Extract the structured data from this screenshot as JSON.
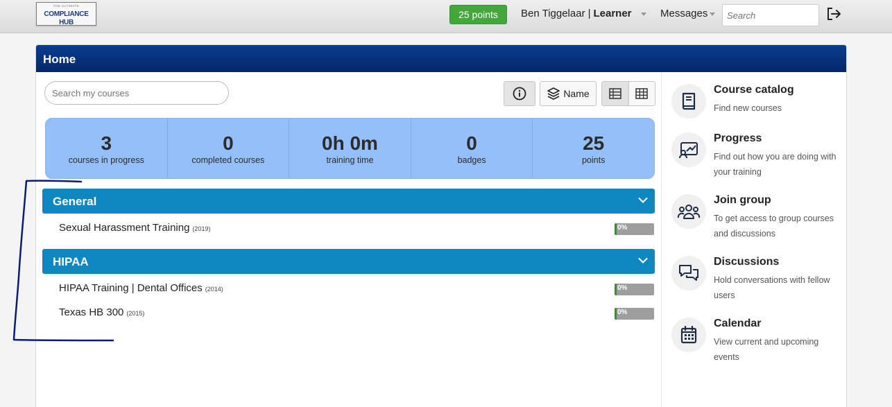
{
  "topbar": {
    "logo_small": "THE ULTIMATE",
    "logo_main": "COMPLIANCE HUB",
    "points_badge": "25 points",
    "user_name": "Ben Tiggelaar",
    "separator": "|",
    "user_role": "Learner",
    "messages_label": "Messages",
    "search_placeholder": "Search"
  },
  "page": {
    "title": "Home"
  },
  "toolbar": {
    "search_placeholder": "Search my courses",
    "sort_label": "Name"
  },
  "stats": [
    {
      "value": "3",
      "label": "courses in progress"
    },
    {
      "value": "0",
      "label": "completed courses"
    },
    {
      "value": "0h 0m",
      "label": "training time"
    },
    {
      "value": "0",
      "label": "badges"
    },
    {
      "value": "25",
      "label": "points"
    }
  ],
  "groups": [
    {
      "name": "General",
      "courses": [
        {
          "title": "Sexual Harassment Training",
          "year": "(2019)",
          "progress": "0%",
          "progress_value": 0
        }
      ]
    },
    {
      "name": "HIPAA",
      "courses": [
        {
          "title": "HIPAA Training | Dental Offices",
          "year": "(2014)",
          "progress": "0%",
          "progress_value": 0
        },
        {
          "title": "Texas HB 300",
          "year": "(2015)",
          "progress": "0%",
          "progress_value": 0
        }
      ]
    }
  ],
  "sidebar": {
    "items": [
      {
        "title": "Course catalog",
        "desc": "Find new courses",
        "icon": "book-icon"
      },
      {
        "title": "Progress",
        "desc": "Find out how you are doing with your training",
        "icon": "progress-chart-icon"
      },
      {
        "title": "Join group",
        "desc": "To get access to group courses and discussions",
        "icon": "group-icon"
      },
      {
        "title": "Discussions",
        "desc": "Hold conversations with fellow users",
        "icon": "chat-icon"
      },
      {
        "title": "Calendar",
        "desc": "View current and upcoming events",
        "icon": "calendar-icon"
      }
    ]
  },
  "colors": {
    "header": "#03286a",
    "group_bar": "#0e87c1",
    "stats_bg": "#94bff8",
    "points_badge": "#46a63e",
    "annotation": "#0c1a78"
  }
}
